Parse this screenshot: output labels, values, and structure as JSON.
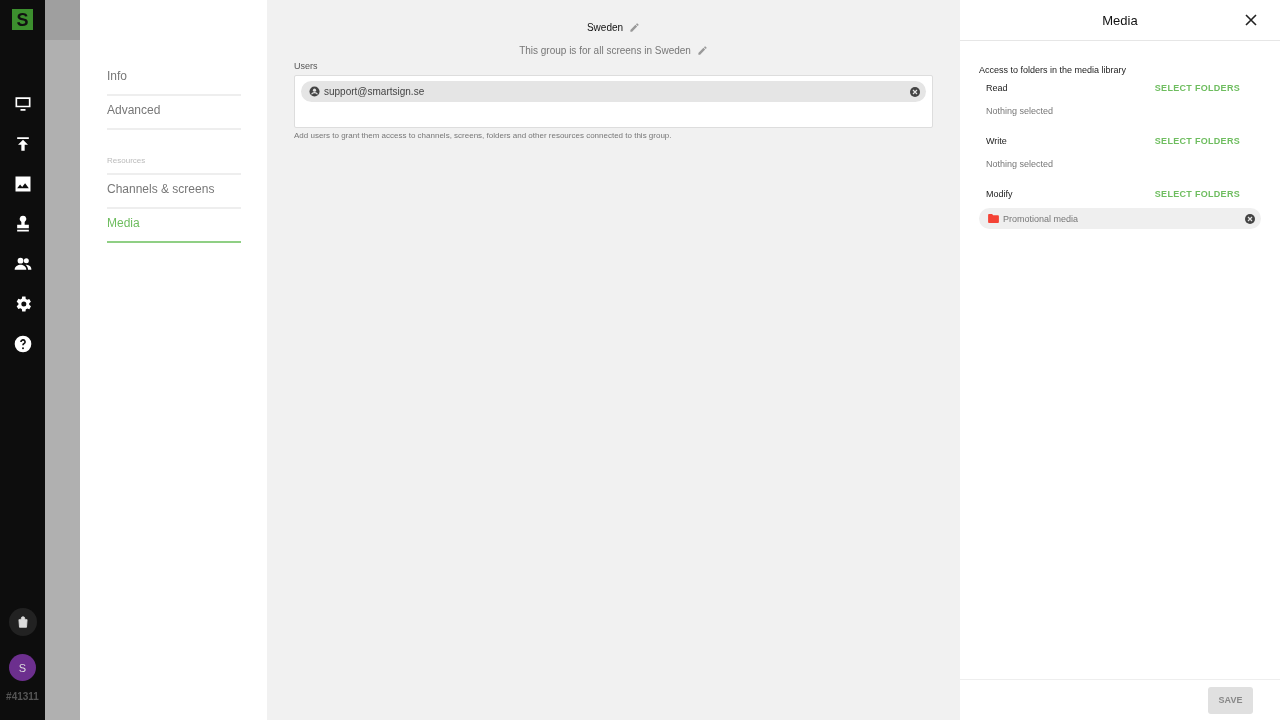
{
  "rail": {
    "logo": "S",
    "avatar": "S",
    "account_id": "#41311"
  },
  "nav": {
    "items": [
      {
        "label": "Info",
        "selected": false
      },
      {
        "label": "Advanced",
        "selected": false
      }
    ],
    "section_label": "Resources",
    "resource_items": [
      {
        "label": "Channels & screens",
        "selected": false
      },
      {
        "label": "Media",
        "selected": true
      }
    ]
  },
  "group": {
    "name": "Sweden",
    "description": "This group is for all screens in Sweden",
    "users_label": "Users",
    "users": [
      "support@smartsign.se"
    ],
    "users_hint": "Add users to grant them access to channels, screens, folders and other resources connected to this group."
  },
  "panel": {
    "title": "Media",
    "intro": "Access to folders in the media library",
    "permissions": [
      {
        "label": "Read",
        "action": "SELECT FOLDERS",
        "empty_text": "Nothing selected"
      },
      {
        "label": "Write",
        "action": "SELECT FOLDERS",
        "empty_text": "Nothing selected"
      },
      {
        "label": "Modify",
        "action": "SELECT FOLDERS",
        "folders": [
          "Promotional media"
        ]
      }
    ],
    "save": {
      "label": "SAVE",
      "disabled": true
    }
  }
}
